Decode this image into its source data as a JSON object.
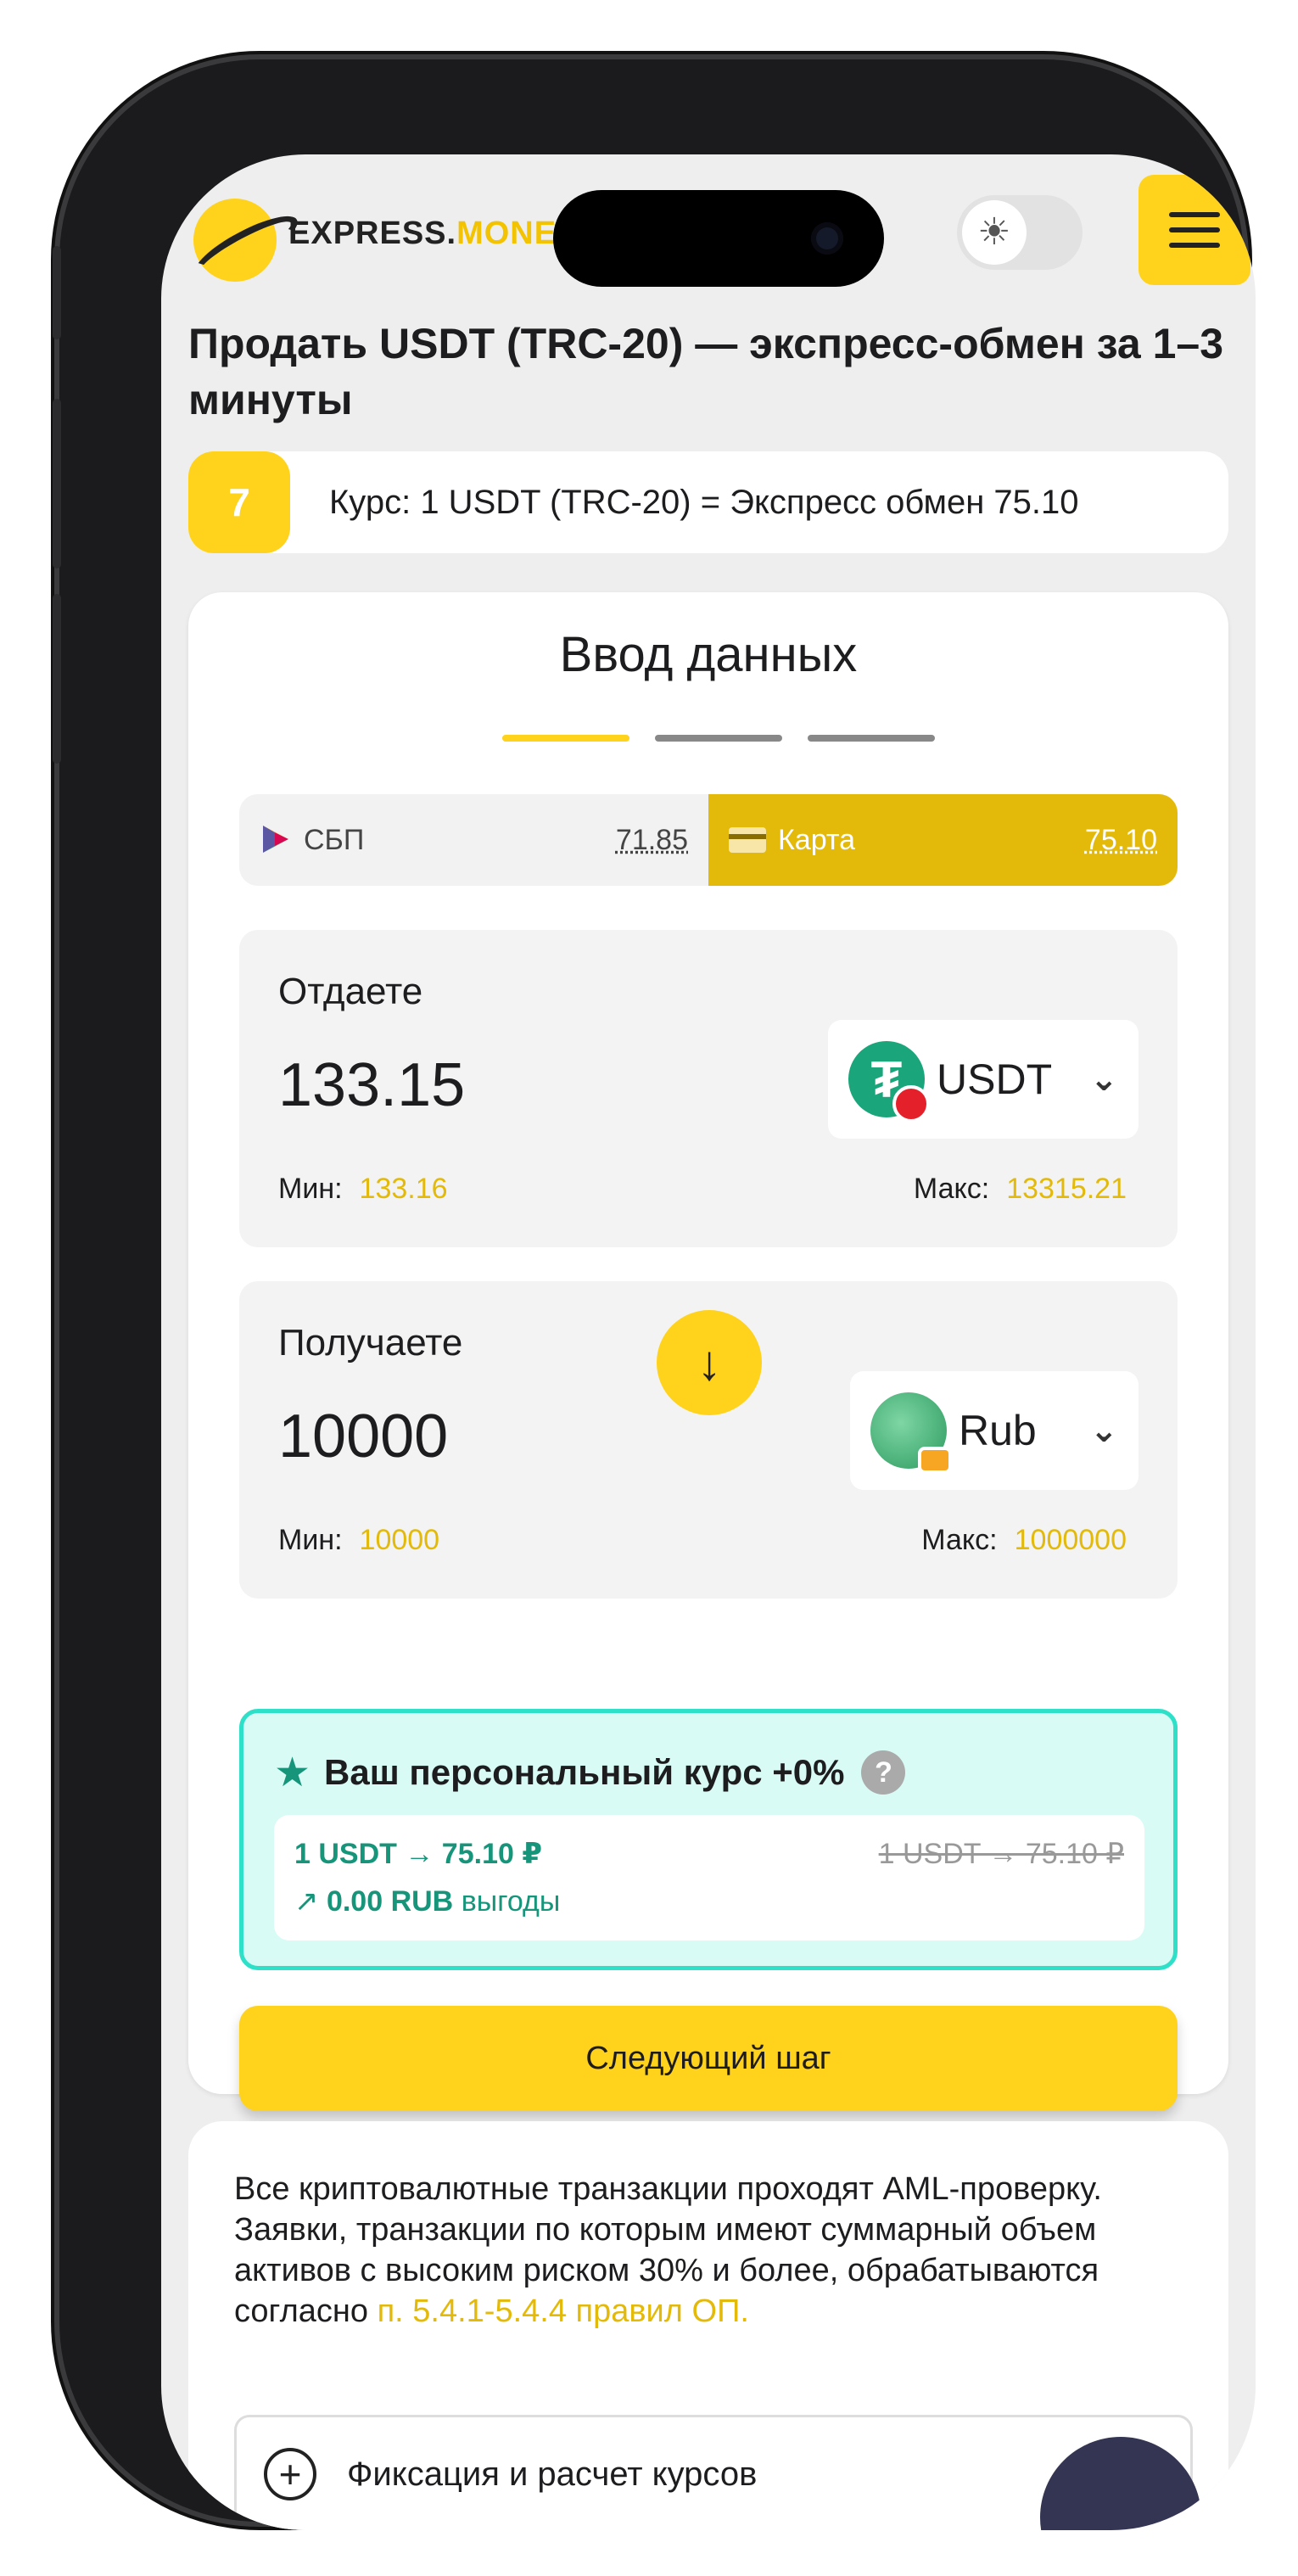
{
  "header": {
    "logo_main": "EXPRESS.",
    "logo_accent": "MONE",
    "theme_icon": "sun-icon",
    "menu_icon": "hamburger-icon"
  },
  "page": {
    "title": "Продать USDT (TRC-20) — экспресс-обмен за 1–3 минуты"
  },
  "rate_bar": {
    "number": "7",
    "text": "Курс: 1 USDT (TRC-20) = Экспресс обмен 75.10"
  },
  "form": {
    "title": "Ввод данных",
    "payment_tabs": [
      {
        "label": "СБП",
        "rate": "71.85",
        "active": false
      },
      {
        "label": "Карта",
        "rate": "75.10",
        "active": true
      }
    ],
    "give": {
      "label": "Отдаете",
      "amount": "133.15",
      "currency": "USDT",
      "min_label": "Мин:",
      "min_value": "133.16",
      "max_label": "Макс:",
      "max_value": "13315.21"
    },
    "receive": {
      "label": "Получаете",
      "amount": "10000",
      "currency": "Rub",
      "min_label": "Мин:",
      "min_value": "10000",
      "max_label": "Макс:",
      "max_value": "1000000"
    },
    "personal_rate": {
      "title": "Ваш персональный курс +0%",
      "help": "?",
      "rate": "1 USDT → 75.10 ₽",
      "old_rate": "1 USDT → 75.10 ₽",
      "profit_value": "0.00 RUB",
      "profit_suffix": "выгоды"
    },
    "next_button": "Следующий шаг"
  },
  "info": {
    "text": "Все криптовалютные транзакции проходят AML-проверку. Заявки, транзакции по которым имеют суммарный объем активов с высоким риском 30% и более, обрабатываются согласно ",
    "link": "п. 5.4.1-5.4.4 правил ОП.",
    "accordion_label": "Фиксация и расчет курсов"
  },
  "colors": {
    "accent": "#ffd21c",
    "accent_dark": "#e3b90a",
    "green": "#17957a",
    "teal_border": "#2fe0c8"
  }
}
